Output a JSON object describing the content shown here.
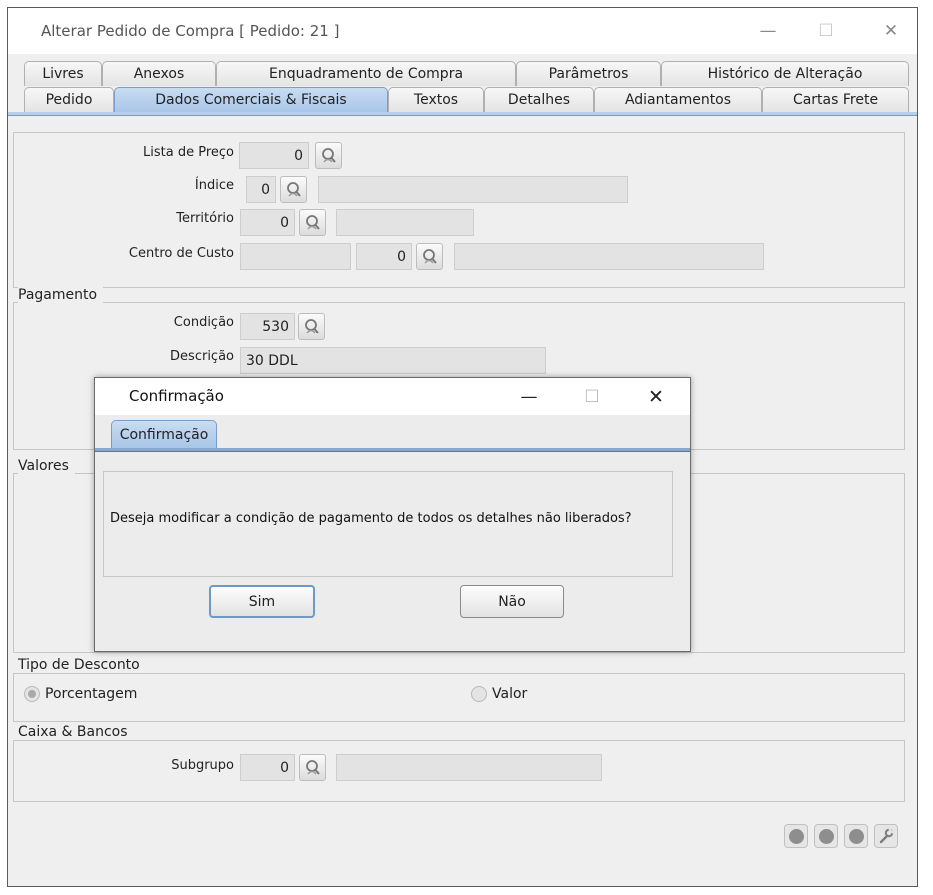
{
  "window": {
    "title": "Alterar Pedido de Compra [ Pedido: 21 ]",
    "controls": {
      "minimize": "—",
      "maximize": "☐",
      "close": "✕"
    }
  },
  "tabs_row1": [
    "Livres",
    "Anexos",
    "Enquadramento de Compra",
    "Parâmetros",
    "Histórico de Alteração"
  ],
  "tabs_row2": [
    "Pedido",
    "Dados Comerciais & Fiscais",
    "Textos",
    "Detalhes",
    "Adiantamentos",
    "Cartas Frete"
  ],
  "active_tab": "Dados Comerciais & Fiscais",
  "general": {
    "lista_preco": {
      "label": "Lista de Preço",
      "value": "0"
    },
    "indice": {
      "label": "Índice",
      "value": "0",
      "desc": ""
    },
    "territorio": {
      "label": "Território",
      "value": "0",
      "desc": ""
    },
    "centro_custo": {
      "label": "Centro de Custo",
      "code": "",
      "value": "0",
      "desc": ""
    }
  },
  "pagamento": {
    "section": "Pagamento",
    "condicao": {
      "label": "Condição",
      "value": "530"
    },
    "descricao": {
      "label": "Descrição",
      "value": "30 DDL"
    }
  },
  "valores": {
    "section": "Valores"
  },
  "tipo_desconto": {
    "section": "Tipo de Desconto",
    "options": [
      "Porcentagem",
      "Valor"
    ],
    "selected": "Porcentagem"
  },
  "caixa_bancos": {
    "section": "Caixa & Bancos",
    "subgrupo": {
      "label": "Subgrupo",
      "value": "0",
      "desc": ""
    }
  },
  "dialog": {
    "title": "Confirmação",
    "tab": "Confirmação",
    "message": "Deseja modificar a condição de pagamento de todos os detalhes não liberados?",
    "yes": "Sim",
    "no": "Não",
    "controls": {
      "minimize": "—",
      "maximize": "☐",
      "close": "✕"
    }
  },
  "colors": {
    "active_tab": "#a9c6e8",
    "tab_line": "#7f99bd",
    "default_button_border": "#6f98c8"
  }
}
